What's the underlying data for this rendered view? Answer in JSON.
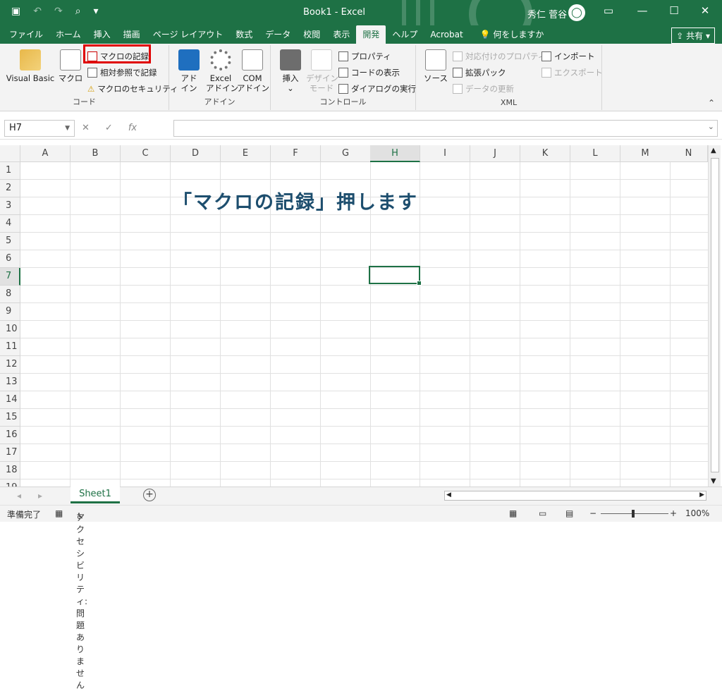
{
  "titlebar": {
    "title": "Book1  -  Excel",
    "user": "秀仁 菅谷",
    "share_label": "共有",
    "colors": {
      "brand": "#1e7145"
    }
  },
  "qat": {
    "save_icon": "save-icon",
    "undo_icon": "undo-icon",
    "redo_icon": "redo-icon",
    "preview_icon": "print-preview-icon"
  },
  "tabs": [
    "ファイル",
    "ホーム",
    "挿入",
    "描画",
    "ページ レイアウト",
    "数式",
    "データ",
    "校閲",
    "表示",
    "開発",
    "ヘルプ",
    "Acrobat"
  ],
  "active_tab": "開発",
  "tell_me": "何をしますか",
  "ribbon": {
    "code": {
      "title": "コード",
      "visual_basic": "Visual Basic",
      "macro": "マクロ",
      "record_macro": "マクロの記録",
      "relative_ref": "相対参照で記録",
      "macro_security": "マクロのセキュリティ"
    },
    "addins": {
      "title": "アドイン",
      "addin": "アド\nイン",
      "excel_addin": "Excel\nアドイン",
      "com_addin": "COM\nアドイン"
    },
    "controls": {
      "title": "コントロール",
      "insert": "挿入",
      "design_mode": "デザイン\nモード",
      "properties": "プロパティ",
      "view_code": "コードの表示",
      "run_dialog": "ダイアログの実行"
    },
    "xml": {
      "title": "XML",
      "source": "ソース",
      "map_properties": "対応付けのプロパティ",
      "expansion_packs": "拡張パック",
      "refresh_data": "データの更新",
      "import": "インポート",
      "export": "エクスポート"
    }
  },
  "formula_bar": {
    "name_box": "H7",
    "fx": "fx",
    "value": ""
  },
  "columns": [
    "A",
    "B",
    "C",
    "D",
    "E",
    "F",
    "G",
    "H",
    "I",
    "J",
    "K",
    "L",
    "M",
    "N"
  ],
  "rows": [
    "1",
    "2",
    "3",
    "4",
    "5",
    "6",
    "7",
    "8",
    "9",
    "10",
    "11",
    "12",
    "13",
    "14",
    "15",
    "16",
    "17",
    "18",
    "19"
  ],
  "selected_cell": "H7",
  "annotation": "「マクロの記録」押します",
  "sheets": [
    "Sheet1"
  ],
  "status": {
    "ready": "準備完了",
    "accessibility": "アクセシビリティ: 問題ありません",
    "zoom": "100%"
  }
}
